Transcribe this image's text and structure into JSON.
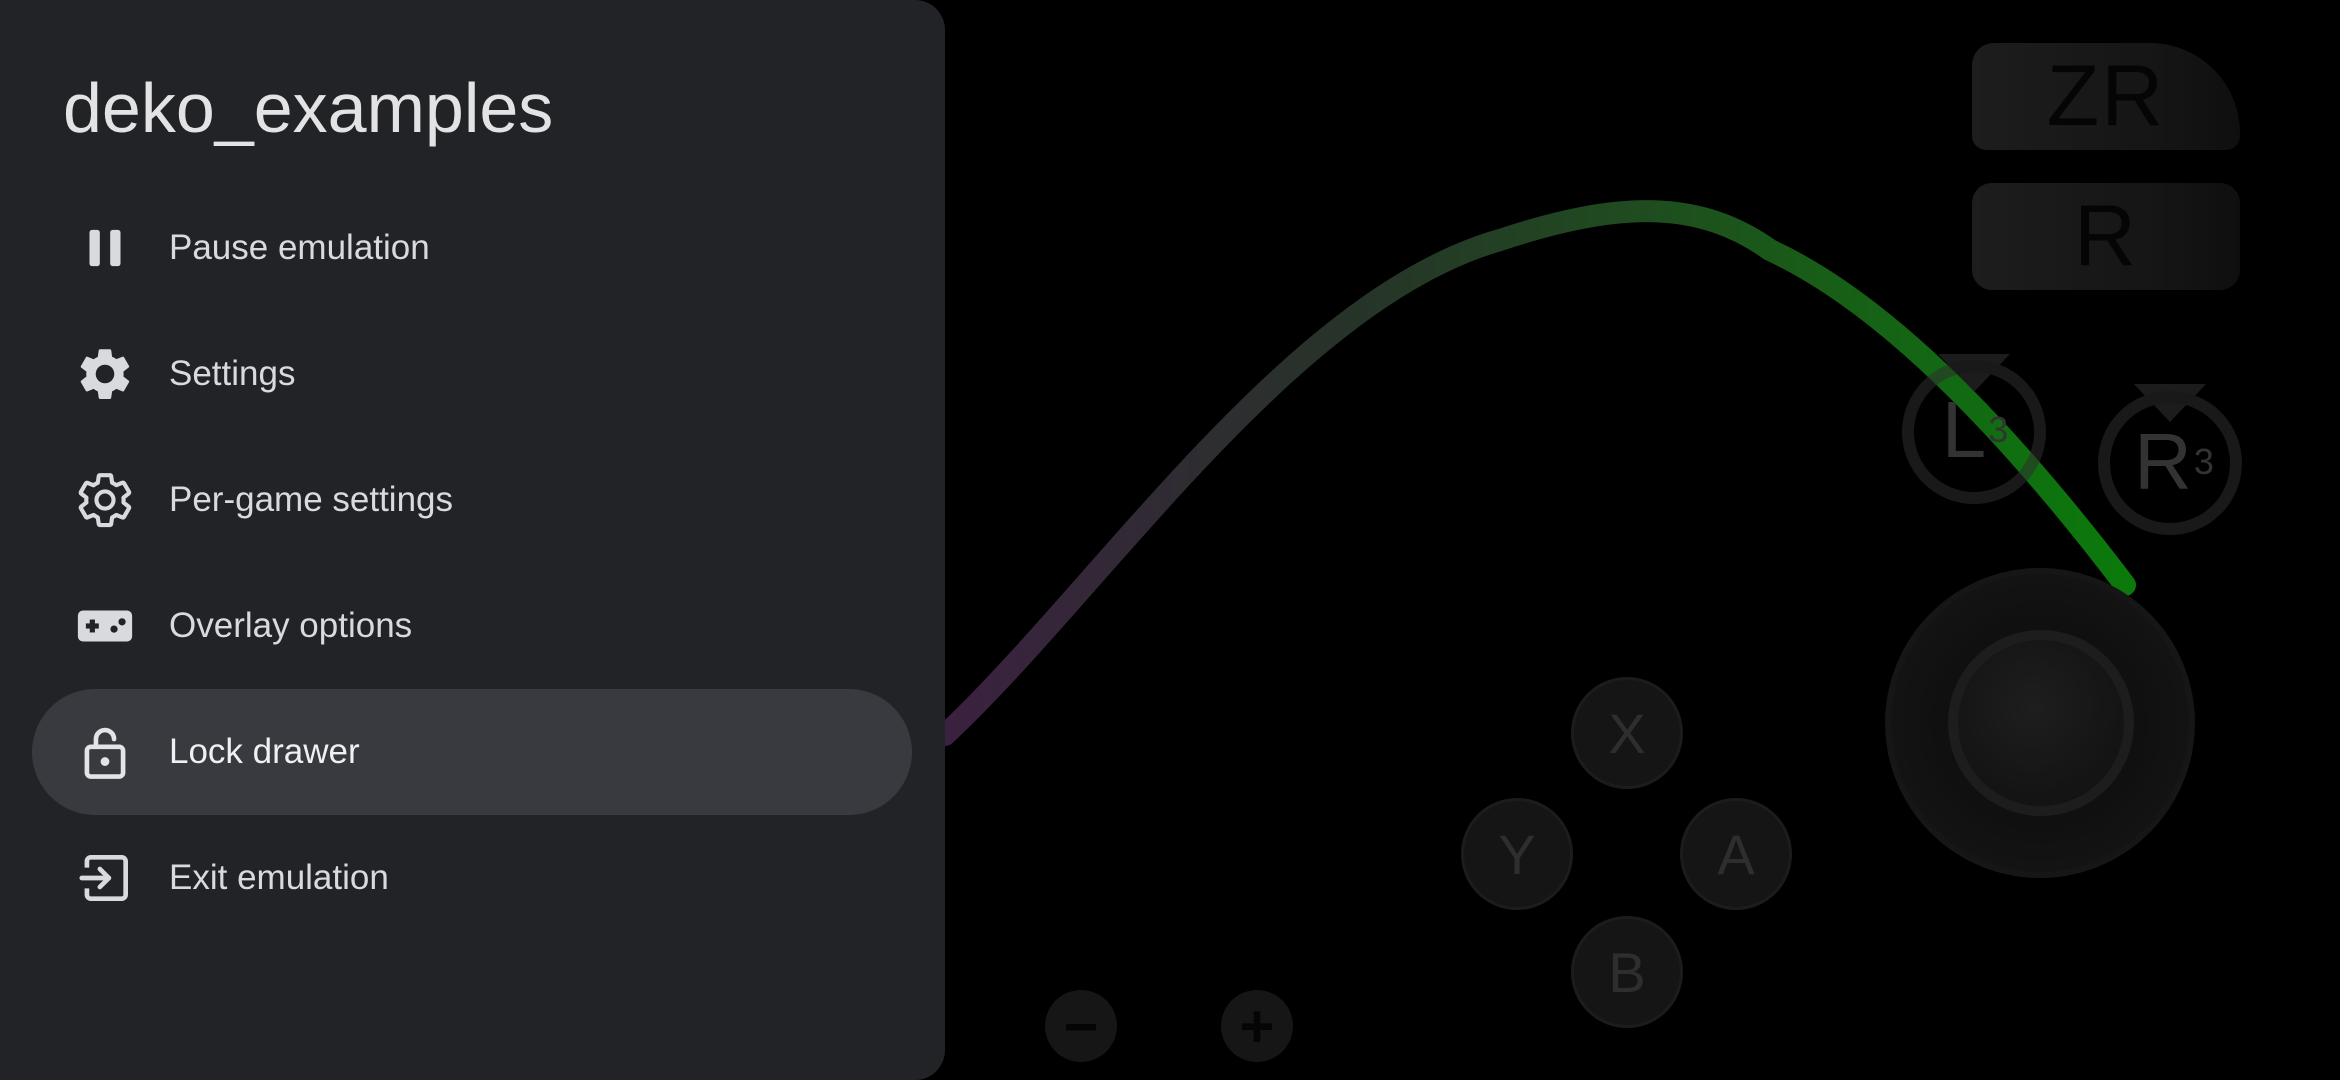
{
  "drawer": {
    "title": "deko_examples",
    "items": [
      {
        "label": "Pause emulation",
        "icon": "pause-icon"
      },
      {
        "label": "Settings",
        "icon": "gear-filled-icon"
      },
      {
        "label": "Per-game settings",
        "icon": "gear-outline-icon"
      },
      {
        "label": "Overlay options",
        "icon": "gamepad-icon"
      },
      {
        "label": "Lock drawer",
        "icon": "lock-open-icon",
        "active": true
      },
      {
        "label": "Exit emulation",
        "icon": "exit-icon"
      }
    ]
  },
  "overlay": {
    "zr": "ZR",
    "r": "R",
    "l3": "L",
    "l3_sup": "3",
    "r3": "R",
    "r3_sup": "3",
    "x": "X",
    "y": "Y",
    "a": "A",
    "b": "B",
    "minus": "−",
    "plus": "+"
  },
  "colors": {
    "drawer_bg": "#222326",
    "active_item_bg": "#383a3f",
    "curve_start": "#3b2140",
    "curve_end": "#0b7a0b"
  }
}
